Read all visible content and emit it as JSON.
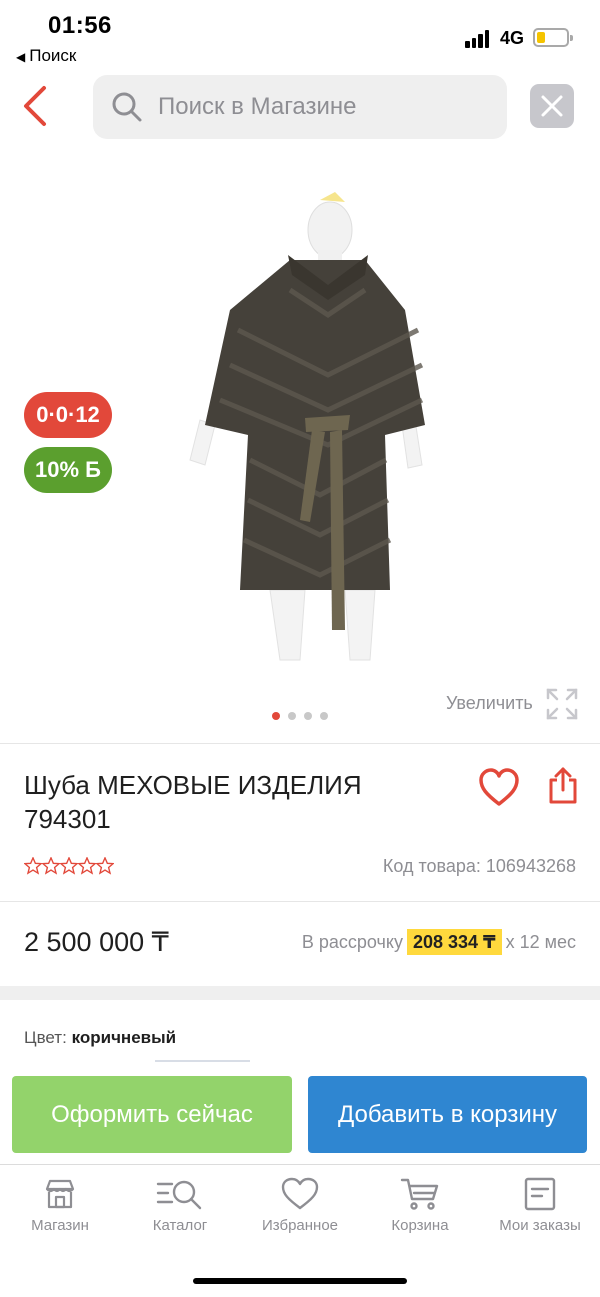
{
  "status_bar": {
    "time": "01:56",
    "back_app": "Поиск",
    "network": "4G"
  },
  "header": {
    "search_placeholder": "Поиск в Магазине",
    "back_icon": "chevron-left-icon",
    "clear_icon": "close-icon"
  },
  "gallery": {
    "badge_installment": "0·0·12",
    "badge_bonus": "10%",
    "badge_bonus_sym": "Б",
    "zoom_label": "Увеличить",
    "dots_total": 4,
    "dots_active": 0
  },
  "product": {
    "title": "Шуба МЕХОВЫЕ ИЗДЕЛИЯ 794301",
    "rating": 0,
    "sku_label": "Код товара: 106943268",
    "price": "2 500 000 ₸",
    "installment_prefix": "В рассрочку",
    "installment_amount": "208 334 ₸",
    "installment_suffix": "х 12 мес",
    "color_label": "Цвет:",
    "color_value": "коричневый"
  },
  "actions": {
    "buy_now": "Оформить сейчас",
    "add_to_cart": "Добавить в корзину"
  },
  "tabbar": [
    {
      "label": "Магазин",
      "icon": "store-icon"
    },
    {
      "label": "Каталог",
      "icon": "catalog-search-icon"
    },
    {
      "label": "Избранное",
      "icon": "heart-icon"
    },
    {
      "label": "Корзина",
      "icon": "cart-icon"
    },
    {
      "label": "Мои заказы",
      "icon": "orders-icon"
    }
  ],
  "colors": {
    "accent_red": "#e2483a",
    "bonus_green": "#5b9f2e",
    "buy_green": "#93d36b",
    "cart_blue": "#2f86d1",
    "installment_yellow": "#ffd93d"
  }
}
